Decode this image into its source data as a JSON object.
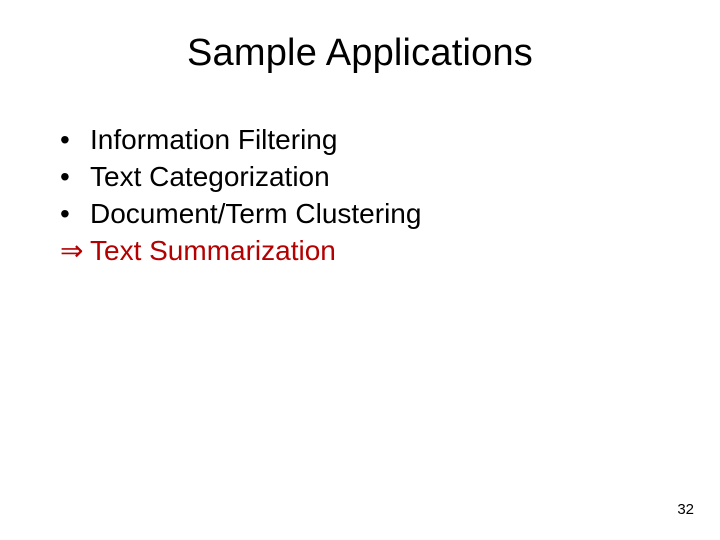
{
  "title": "Sample Applications",
  "bullets": {
    "item0": {
      "symbol": "•",
      "text": "Information Filtering"
    },
    "item1": {
      "symbol": "•",
      "text": "Text Categorization"
    },
    "item2": {
      "symbol": "•",
      "text": "Document/Term Clustering"
    },
    "item3": {
      "symbol": "⇒",
      "text": "Text Summarization"
    }
  },
  "page_number": "32",
  "colors": {
    "highlight": "#b40000",
    "text": "#000000",
    "background": "#ffffff"
  }
}
